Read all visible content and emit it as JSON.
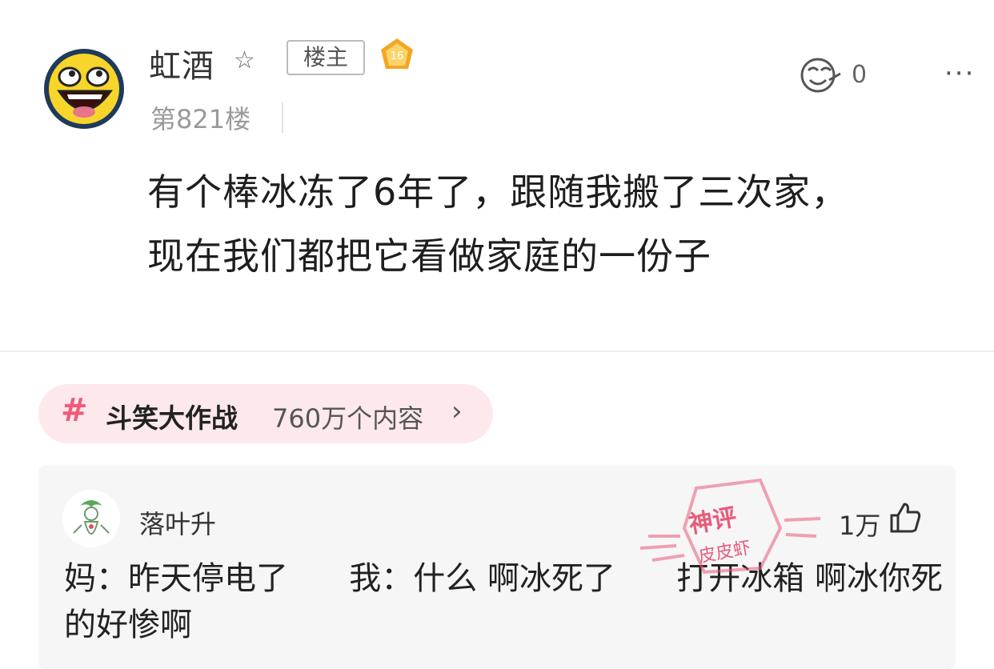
{
  "post": {
    "username": "虹酒",
    "op_badge": "楼主",
    "level": "16",
    "floor": "第821楼",
    "reply_count": "0",
    "content_line1": "有个棒冰冻了6年了，跟随我搬了三次家，",
    "content_line2": "现在我们都把它看做家庭的一份子"
  },
  "topic": {
    "hash": "#",
    "name": "斗笑大作战",
    "count": "760万个内容"
  },
  "comment": {
    "username": "落叶升",
    "likes": "1万",
    "text": "妈：昨天停电了      我：什么 啊冰死了      打开冰箱 啊冰你死的好惨啊"
  },
  "watermark": {
    "line1": "神评",
    "line2": "皮皮虾"
  },
  "colors": {
    "accent": "#ef5b7a",
    "pill_bg": "#fde9ec",
    "comment_bg": "#f6f6f6"
  }
}
